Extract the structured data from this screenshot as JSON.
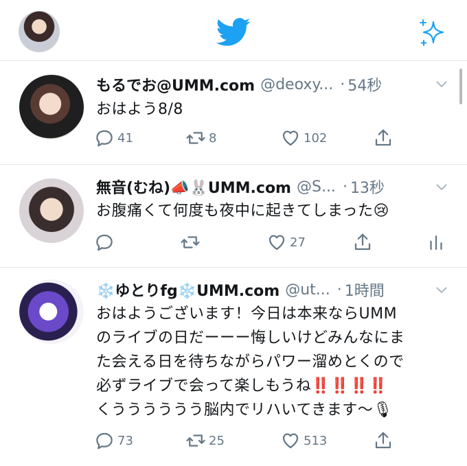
{
  "tweets": [
    {
      "name": "もるでお@UMM.com",
      "handle": "@deoxy...",
      "dot": "·",
      "time": "54秒",
      "text": "おはよう8/8",
      "replies": "41",
      "retweets": "8",
      "likes": "102"
    },
    {
      "name": "無音(むね)📣🐰UMM.com",
      "handle": "@S...",
      "dot": "·",
      "time": "13秒",
      "text": "お腹痛くて何度も夜中に起きてしまった😢",
      "replies": "",
      "retweets": "",
      "likes": "27"
    },
    {
      "name": "❄️ゆとりfg❄️UMM.com",
      "handle": "@ut...",
      "dot": "·",
      "time": "1時間",
      "text_lines": [
        "おはようございます！今日は本来ならUMM",
        "のライブの日だーーー悔しいけどみんなにま",
        "た会える日を待ちながらパワー溜めとくので",
        "必ずライブで会って楽しもうね‼️‼️‼️‼️",
        "くうううううう脳内でリハいてきます〜🎙"
      ],
      "replies": "73",
      "retweets": "25",
      "likes": "513"
    }
  ],
  "icons": {
    "brand": "twitter-bird-icon",
    "compose": "sparkle-icon"
  },
  "colors": {
    "brand": "#1da1f2",
    "text": "#14171a",
    "muted": "#657786",
    "divider": "#e1e8ed"
  }
}
